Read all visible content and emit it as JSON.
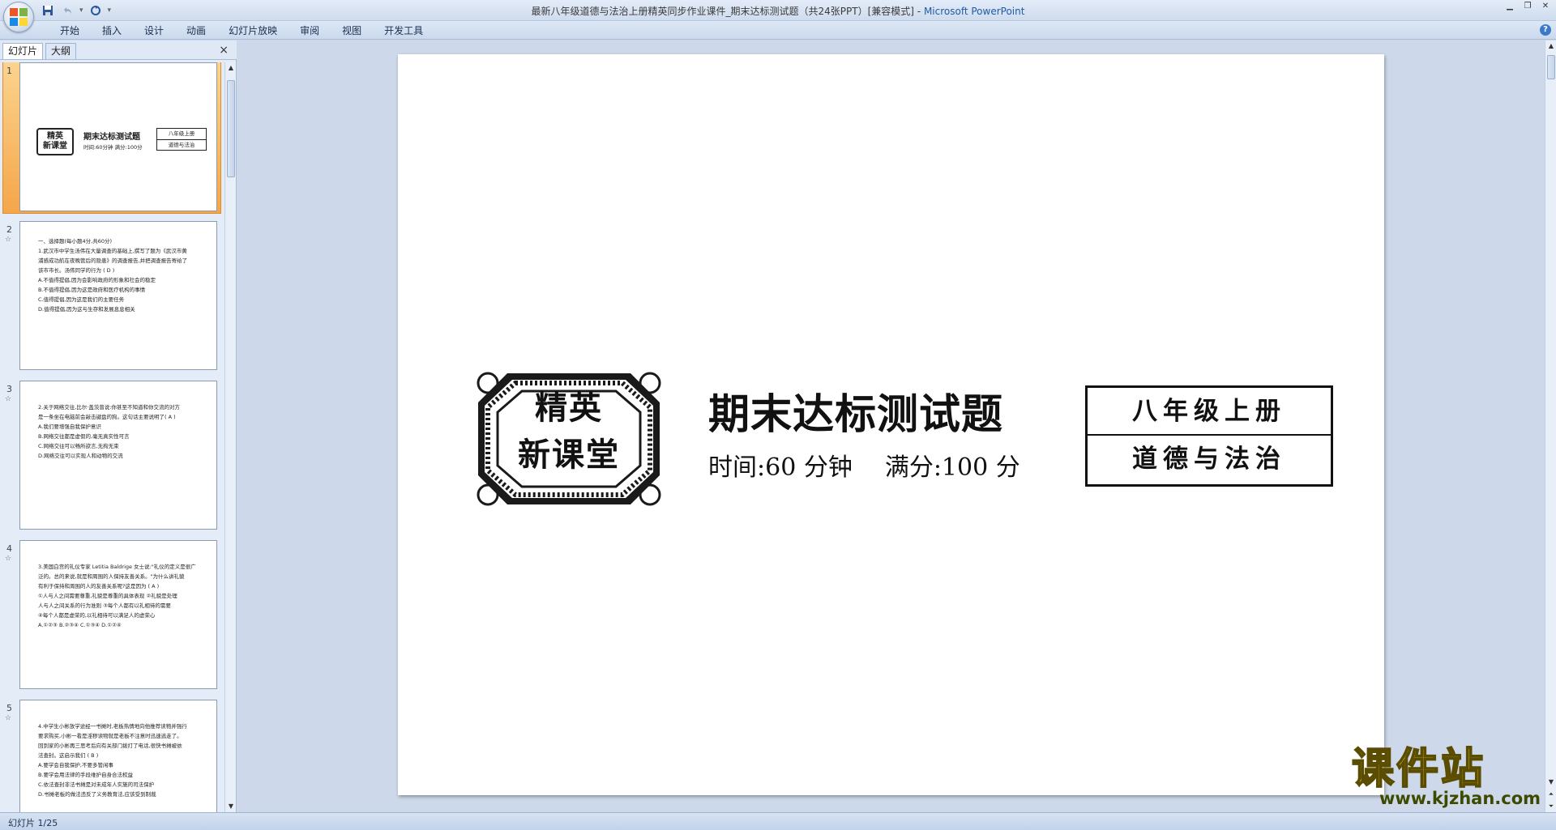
{
  "window": {
    "title": "最新八年级道德与法治上册精英同步作业课件_期末达标测试题（共24张PPT）[兼容模式]",
    "app_name": "Microsoft PowerPoint",
    "title_separator": " - "
  },
  "quick_access": {
    "save_icon": "save-icon",
    "undo_icon": "undo-icon",
    "redo_icon": "redo-icon",
    "customize_glyph": "▾"
  },
  "ribbon": {
    "tabs": [
      "开始",
      "插入",
      "设计",
      "动画",
      "幻灯片放映",
      "审阅",
      "视图",
      "开发工具"
    ]
  },
  "left_panel": {
    "tab_slides": "幻灯片",
    "tab_outline": "大纲",
    "close_glyph": "×"
  },
  "thumbnails": [
    {
      "number": "1",
      "mini": {
        "emblem": "精英\n新课堂",
        "title": "期末达标测试题",
        "sub": "时间:60分钟   满分:100分",
        "box_top": "八年级上册",
        "box_bottom": "道德与法治"
      }
    },
    {
      "number": "2",
      "lines": [
        "一、选择题(每小题4分,共60分)",
        "1.武汉市中学生汤伟在大量调查的基础上,撰写了题为《武汉市黄",
        "浦感成功航在夜晚管后的隐患》的调查报告,并把调查报告寄给了",
        "该市市长。汤伟同学的行为                              ( D )",
        "A.不值得提倡,因为会影响政府的形象和社会的稳定",
        "B.不值得提倡,因为这是政府和医疗机构的事情",
        "C.值得提倡,因为这是我们的主要任务",
        "D.值得提倡,因为这与生存和发展息息相关"
      ]
    },
    {
      "number": "3",
      "lines": [
        "2.关于网络交往,比尔·盖茨曾说:你甚至不知道和你交流的对方",
        "是一条坐在电脑前会敲击键盘的狗。这句话主要说明了(  A  )",
        "A.我们要增强自我保护意识",
        "B.网络交往都是虚假的,毫无真实性可言",
        "C.网络交往可以畅所欲言,无拘无束",
        "D.网络交往可以实现人和动物的交流"
      ]
    },
    {
      "number": "4",
      "lines": [
        "3.美国白宫的礼仪专家 Letitia Baldrige 女士说:\"礼仪的定义是很广",
        "泛的。总的来说,就是和周围的人保持友善关系。\"为什么讲礼貌",
        "有利于保持和周围的人的友善关系呢?这是因为          ( A )",
        "①人与人之间需要尊重,礼貌是尊重的具体表现  ②礼貌是处理",
        "人与人之间关系的行为准则  ③每个人都有以礼相待的需要",
        "④每个人都是虚荣的,以礼相待可以满足人的虚荣心",
        "A.①②③        B.②③④        C.①③④        D.①②④"
      ]
    },
    {
      "number": "5",
      "lines": [
        "4.中学生小彬放学途经一书摊时,老板热情地向他推荐读物并强行",
        "要求购买,小彬一看是淫秽读物就是老板不注意时迅速逃走了。",
        "回到家的小彬再三思考后向有关部门拨打了电话,很快书摊被依",
        "法查封。这启示我们                                       ( B )",
        "A.要学会自我保护,不要多管闲事",
        "B.要学会用法律的手段维护自身合法权益",
        "C.依法查封非法书摊是对未成年人实施的司法保护",
        "D.书摊老板的做法违反了义务教育法,应该受到制裁"
      ]
    }
  ],
  "slide": {
    "emblem_text": "精英\n新课堂",
    "title": "期末达标测试题",
    "time_text": "时间:60 分钟",
    "score_text": "满分:100 分",
    "box_top": "八年级上册",
    "box_bottom": "道德与法治"
  },
  "watermark": {
    "text": "课件站",
    "url": "www.kjzhan.com"
  },
  "status_bar": {
    "slide_indicator": "幻灯片 1/25"
  },
  "colors": {
    "app_name_blue": "#1f5aa6",
    "selected_thumb": "#f5a64a",
    "workspace_bg": "#cdd9ea",
    "watermark_yellow": "#f4d80d"
  }
}
